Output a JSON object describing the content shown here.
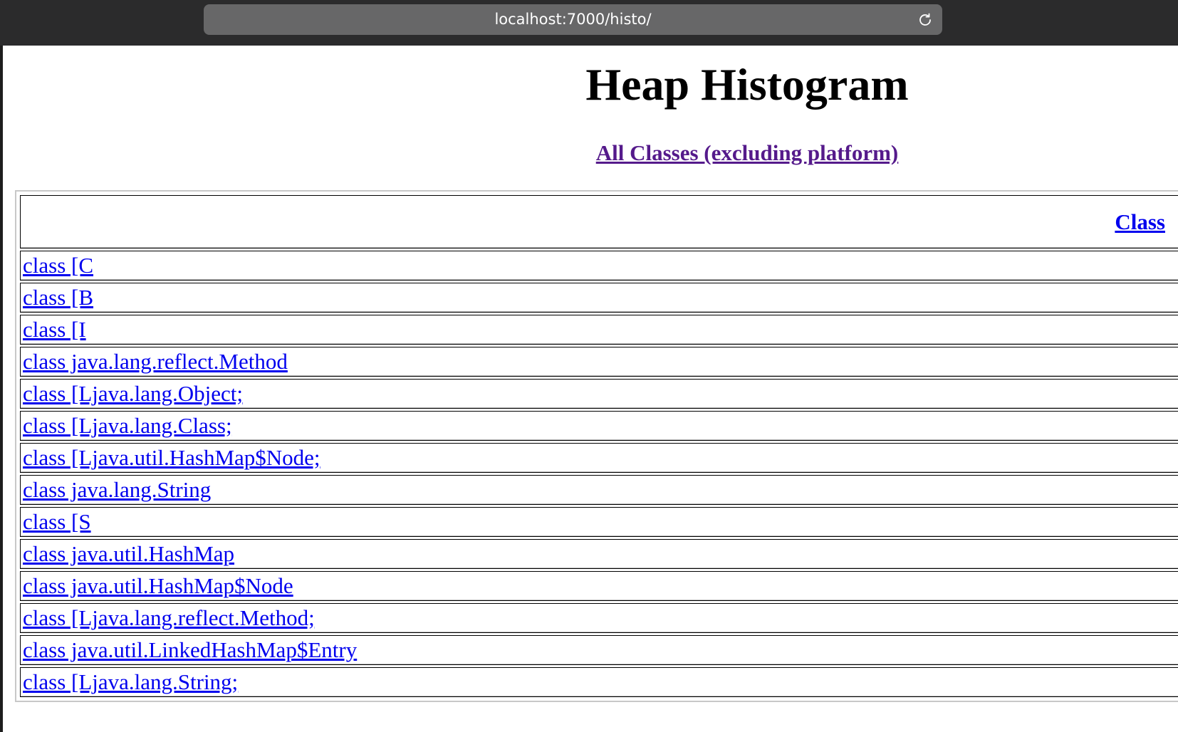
{
  "browser": {
    "url": "localhost:7000/histo/",
    "reload_icon": "reload-icon"
  },
  "page": {
    "title": "Heap Histogram",
    "all_classes_link": "All Classes (excluding platform)"
  },
  "table": {
    "header_class": "Class",
    "rows": [
      "class [C",
      "class [B",
      "class [I",
      "class java.lang.reflect.Method",
      "class [Ljava.lang.Object;",
      "class [Ljava.lang.Class;",
      "class [Ljava.util.HashMap$Node;",
      "class java.lang.String",
      "class [S",
      "class java.util.HashMap",
      "class java.util.HashMap$Node",
      "class [Ljava.lang.reflect.Method;",
      "class java.util.LinkedHashMap$Entry",
      "class [Ljava.lang.String;"
    ]
  },
  "colors": {
    "link": "#0000ee",
    "visited_link": "#551a8b",
    "chrome_bg": "#2b2b2c",
    "address_bar_bg": "#676768"
  }
}
